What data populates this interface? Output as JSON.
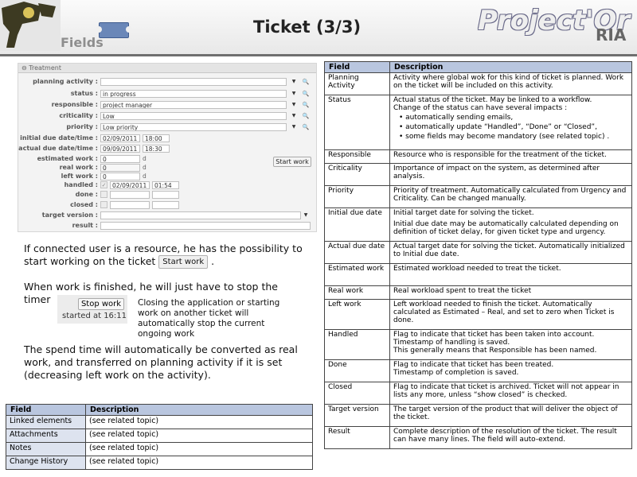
{
  "header": {
    "section": "Fields",
    "title": "Ticket (3/3)",
    "brand": "Project'Or",
    "brand_sub": "RIA"
  },
  "form": {
    "panel_title": "Treatment",
    "planning_activity_label": "planning activity :",
    "planning_activity_value": "",
    "status_label": "status :",
    "status_value": "in progress",
    "responsible_label": "responsible :",
    "responsible_value": "project manager",
    "criticality_label": "criticality :",
    "criticality_value": "Low",
    "priority_label": "priority :",
    "priority_value": "Low priority",
    "initial_due_label": "initial due date/time :",
    "initial_due_date": "02/09/2011",
    "initial_due_time": "18:00",
    "actual_due_label": "actual due date/time :",
    "actual_due_date": "09/09/2011",
    "actual_due_time": "18:30",
    "estimated_work_label": "estimated work :",
    "estimated_work_value": "0",
    "real_work_label": "real work :",
    "real_work_value": "0",
    "left_work_label": "left work :",
    "left_work_value": "0",
    "work_unit": "d",
    "handled_label": "handled :",
    "handled_date": "02/09/2011",
    "handled_time": "01:54",
    "done_label": "done :",
    "closed_label": "closed :",
    "target_version_label": "target version :",
    "target_version_value": "",
    "result_label": "result :",
    "result_value": "",
    "start_work_button": "Start work"
  },
  "text": {
    "para1": "If connected user is a resource, he has the possibility to start working on the ticket",
    "inline_start_button": "Start work",
    "para1_end": ".",
    "para2": "When work is finished, he will just have to stop the timer",
    "stop_button": "Stop work",
    "stop_note": "started at 16:11",
    "side_note": "Closing the application or starting work on another ticket will automatically stop the current ongoing work",
    "para3": "The spend time will automatically be converted as real work, and transferred on planning activity if it is set (decreasing left work on the activity)."
  },
  "small_table": {
    "headers": [
      "Field",
      "Description"
    ],
    "rows": [
      [
        "Linked elements",
        "(see related topic)"
      ],
      [
        "Attachments",
        "(see related topic)"
      ],
      [
        "Notes",
        "(see related topic)"
      ],
      [
        "Change History",
        "(see related topic)"
      ]
    ]
  },
  "main_table": {
    "headers": [
      "Field",
      "Description"
    ],
    "rows": [
      {
        "field": "Planning Activity",
        "desc": [
          "Activity where global wok for this kind of ticket is planned. Work on the ticket will be included on this activity."
        ]
      },
      {
        "field": "Status",
        "desc": [
          "Actual status of the ticket. May be linked to a workflow.",
          "Change of the status can have several impacts :"
        ],
        "bullets": [
          "automatically sending emails,",
          "automatically update “Handled”, “Done” or “Closed”,",
          "some fields may become mandatory (see related topic) ."
        ]
      },
      {
        "field": "Responsible",
        "desc": [
          "Resource who is responsible for the treatment of the ticket."
        ]
      },
      {
        "field": "Criticality",
        "desc": [
          "Importance of impact on the system, as determined after analysis."
        ]
      },
      {
        "field": "Priority",
        "desc": [
          "Priority of treatment. Automatically calculated from Urgency and Criticality. Can be changed manually."
        ]
      },
      {
        "field": "Initial due date",
        "desc": [
          "Initial target date for solving the ticket.",
          "Initial due date may be automatically calculated depending on definition of ticket delay, for given ticket type and urgency."
        ],
        "spaced": true
      },
      {
        "field": "Actual due date",
        "desc": [
          "Actual target date for solving the ticket. Automatically initialized to Initial due date."
        ]
      },
      {
        "field": "Estimated work",
        "desc": [
          "Estimated workload needed to treat the ticket."
        ]
      },
      {
        "field": "Real work",
        "desc": [
          "Real workload spent to treat the ticket"
        ]
      },
      {
        "field": "Left work",
        "desc": [
          "Left workload needed to finish the ticket. Automatically calculated as Estimated – Real, and set to zero when Ticket is done."
        ]
      },
      {
        "field": "Handled",
        "desc": [
          "Flag to indicate that ticket has been taken into account.",
          "Timestamp of handling is saved.",
          "This generally means that Responsible has been named."
        ]
      },
      {
        "field": "Done",
        "desc": [
          "Flag to indicate that ticket has been treated.",
          "Timestamp of completion is saved."
        ]
      },
      {
        "field": "Closed",
        "desc": [
          "Flag to indicate that ticket is archived. Ticket will not appear in lists any more, unless “show closed” is checked."
        ]
      },
      {
        "field": "Target version",
        "desc": [
          "The target version of the product that will deliver the object of the ticket."
        ]
      },
      {
        "field": "Result",
        "desc": [
          "Complete description of the resolution of the ticket. The result can have many lines. The field will auto-extend."
        ]
      }
    ]
  }
}
